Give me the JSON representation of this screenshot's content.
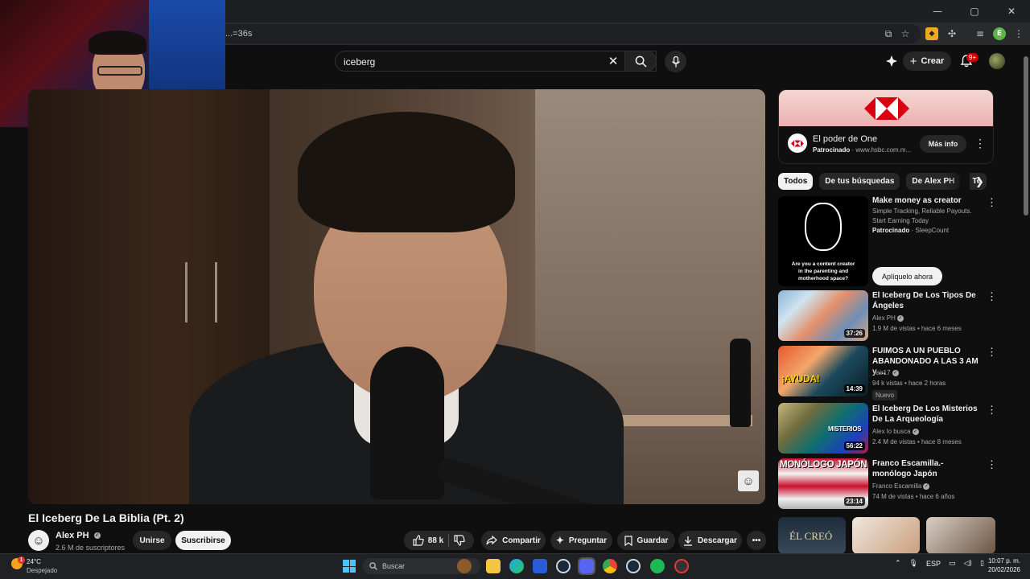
{
  "browser": {
    "url": "...=36s",
    "window_controls": [
      "—",
      "▢",
      "✕"
    ]
  },
  "youtube": {
    "search_value": "iceberg",
    "create_label": "Crear",
    "notifications_badge": "9+"
  },
  "video": {
    "title": "El Iceberg De La Biblia (Pt. 2)",
    "channel": "Alex PH",
    "subscribers": "2.6 M de suscriptores",
    "join_label": "Unirse",
    "subscribe_label": "Suscribirse",
    "likes": "88 k",
    "share_label": "Compartir",
    "ask_label": "Preguntar",
    "save_label": "Guardar",
    "download_label": "Descargar"
  },
  "ad": {
    "title": "El poder de One",
    "sponsored": "Patrocinado",
    "domain": "www.hsbc.com.m...",
    "button": "Más info"
  },
  "chips": [
    "Todos",
    "De tus búsquedas",
    "De Alex PH",
    "Te"
  ],
  "sponsored_video": {
    "title": "Make money as creator",
    "desc1": "Simple Tracking, Reliable Payouts.",
    "desc2": "Start Earning Today",
    "sponsored": "Patrocinado",
    "advertiser": "SleepCount",
    "button": "Aplíquelo ahora",
    "thumb_text": "Are you a content creator in the parenting and motherhood space?"
  },
  "recommendations": [
    {
      "title": "El Iceberg De Los Tipos De Ángeles",
      "channel": "Alex PH",
      "meta": "1.9 M de vistas • hace 6 meses",
      "duration": "37:26"
    },
    {
      "title": "FUIMOS A UN PUEBLO ABANDONADO A LAS 3 AM y ...",
      "channel": "Yair17",
      "meta": "94 k vistas • hace 2 horas",
      "duration": "14:39",
      "badge": "Nuevo",
      "thumb_text": "¡AYUDA!"
    },
    {
      "title": "El Iceberg De Los Misterios De La Arqueología",
      "channel": "Alex lo busca",
      "meta": "2.4 M de vistas • hace 8 meses",
      "duration": "56:22",
      "thumb_text": "MISTERIOS"
    },
    {
      "title": "Franco Escamilla.- monólogo Japón",
      "channel": "Franco Escamilla",
      "meta": "74 M de vistas • hace 6 años",
      "duration": "23:14",
      "thumb_text": "MONÓLOGO JAPÓN"
    }
  ],
  "bottom_row_text": "ÉL CREÓ",
  "taskbar": {
    "weather_badge": "1",
    "temperature": "24°C",
    "weather": "Despejado",
    "search_placeholder": "Buscar",
    "language": "ESP",
    "time": "10:07 p. m.",
    "date": "20/02/2026"
  },
  "colors": {
    "background": "#0f0f0f",
    "youtube_red": "#cc0000",
    "hsbc_red": "#db0011",
    "accent_windows": "#4cc2ff"
  }
}
